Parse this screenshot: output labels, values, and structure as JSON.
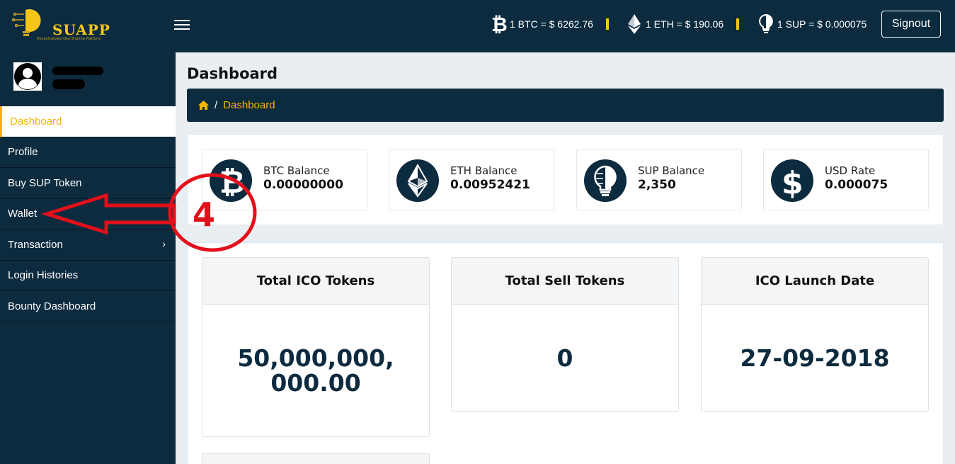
{
  "header": {
    "logo_text": "SUAPP",
    "logo_tagline": "Decentralized Idea Sharing Platform",
    "tickers": [
      {
        "icon": "bitcoin-icon",
        "text": "1 BTC = $ 6262.76"
      },
      {
        "icon": "ethereum-icon",
        "text": "1 ETH = $ 190.06"
      },
      {
        "icon": "sup-bulb-icon",
        "text": "1 SUP = $ 0.000075"
      }
    ],
    "signout_label": "Signout"
  },
  "sidebar": {
    "items": [
      {
        "label": "Dashboard",
        "active": true
      },
      {
        "label": "Profile"
      },
      {
        "label": "Buy SUP Token"
      },
      {
        "label": "Wallet"
      },
      {
        "label": "Transaction",
        "has_submenu": true,
        "chevron": "›"
      },
      {
        "label": "Login Histories"
      },
      {
        "label": "Bounty Dashboard"
      }
    ]
  },
  "main": {
    "page_title": "Dashboard",
    "breadcrumb": {
      "separator": "/",
      "current": "Dashboard"
    },
    "balances": [
      {
        "label": "BTC Balance",
        "value": "0.00000000",
        "icon": "bitcoin-icon"
      },
      {
        "label": "ETH Balance",
        "value": "0.00952421",
        "icon": "ethereum-icon"
      },
      {
        "label": "SUP Balance",
        "value": "2,350",
        "icon": "sup-bulb-icon"
      },
      {
        "label": "USD Rate",
        "value": "0.000075",
        "icon": "dollar-icon"
      }
    ],
    "stats": [
      {
        "title": "Total ICO Tokens",
        "value_line1": "50,000,000,",
        "value_line2": "000.00"
      },
      {
        "title": "Total Sell Tokens",
        "value": "0"
      },
      {
        "title": "ICO Launch Date",
        "value": "27-09-2018"
      }
    ]
  },
  "annotation": {
    "number": "4",
    "color": "#e3101b"
  },
  "colors": {
    "navy": "#0d2b3e",
    "accent": "#f5b400",
    "annotation": "#e3101b"
  }
}
